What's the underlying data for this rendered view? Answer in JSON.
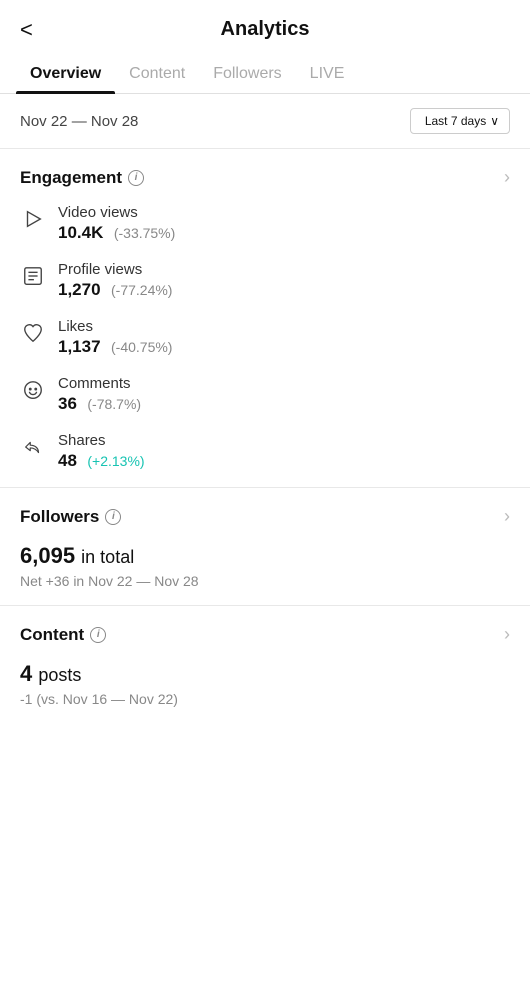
{
  "header": {
    "back_label": "<",
    "title": "Analytics"
  },
  "tabs": [
    {
      "label": "Overview",
      "active": true
    },
    {
      "label": "Content",
      "active": false
    },
    {
      "label": "Followers",
      "active": false
    },
    {
      "label": "LIVE",
      "active": false
    }
  ],
  "date_row": {
    "range": "Nov 22 — Nov 28",
    "filter_label": "Last 7 days",
    "filter_arrow": "∨"
  },
  "engagement": {
    "section_title": "Engagement",
    "info_label": "i",
    "metrics": [
      {
        "icon": "play-icon",
        "label": "Video views",
        "value": "10.4K",
        "change": "(-33.75%)",
        "positive": false
      },
      {
        "icon": "profile-icon",
        "label": "Profile views",
        "value": "1,270",
        "change": "(-77.24%)",
        "positive": false
      },
      {
        "icon": "heart-icon",
        "label": "Likes",
        "value": "1,137",
        "change": "(-40.75%)",
        "positive": false
      },
      {
        "icon": "comment-icon",
        "label": "Comments",
        "value": "36",
        "change": "(-78.7%)",
        "positive": false
      },
      {
        "icon": "share-icon",
        "label": "Shares",
        "value": "48",
        "change": "(+2.13%)",
        "positive": true
      }
    ]
  },
  "followers": {
    "section_title": "Followers",
    "info_label": "i",
    "total_value": "6,095",
    "total_label": "in total",
    "net_text": "Net +36 in Nov 22 — Nov 28"
  },
  "content": {
    "section_title": "Content",
    "info_label": "i",
    "posts_value": "4",
    "posts_label": "posts",
    "compare_text": "-1 (vs. Nov 16 — Nov 22)"
  }
}
